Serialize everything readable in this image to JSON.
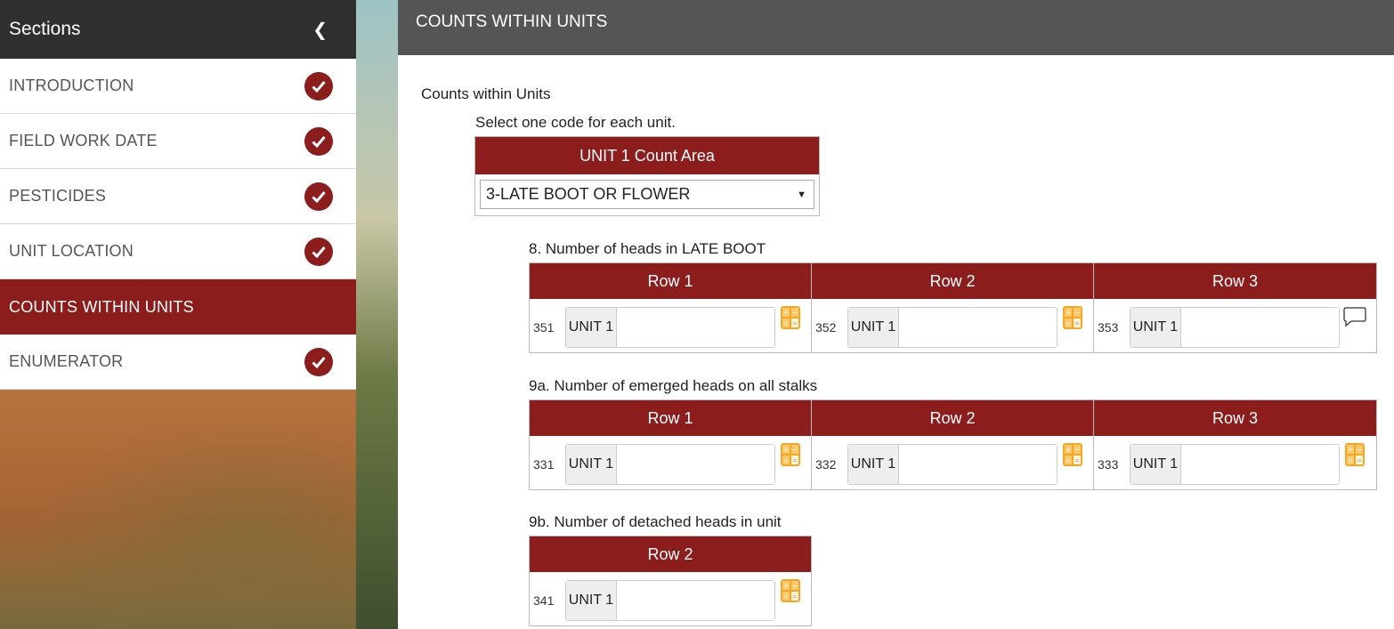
{
  "sidebar": {
    "title": "Sections",
    "collapse_icon": "chevron-left-icon",
    "items": [
      {
        "label": "INTRODUCTION",
        "completed": true
      },
      {
        "label": "FIELD WORK DATE",
        "completed": true
      },
      {
        "label": "PESTICIDES",
        "completed": true
      },
      {
        "label": "UNIT LOCATION",
        "completed": true
      },
      {
        "label": "COUNTS WITHIN UNITS",
        "completed": false,
        "active": true
      },
      {
        "label": "ENUMERATOR",
        "completed": true
      }
    ]
  },
  "main": {
    "header_title": "COUNTS WITHIN UNITS",
    "section_title": "Counts within Units",
    "instruction": "Select one code for each unit.",
    "unit_select": {
      "header": "UNIT 1 Count Area",
      "selected_value": "3-LATE BOOT OR FLOWER"
    },
    "questions": [
      {
        "label": "8. Number of heads in LATE BOOT",
        "columns": [
          {
            "header": "Row 1",
            "code": "351",
            "addon": "UNIT 1",
            "value": ""
          },
          {
            "header": "Row 2",
            "code": "352",
            "addon": "UNIT 1",
            "value": ""
          },
          {
            "header": "Row 3",
            "code": "353",
            "addon": "UNIT 1",
            "value": ""
          }
        ]
      },
      {
        "label": "9a. Number of emerged heads on all stalks",
        "columns": [
          {
            "header": "Row 1",
            "code": "331",
            "addon": "UNIT 1",
            "value": ""
          },
          {
            "header": "Row 2",
            "code": "332",
            "addon": "UNIT 1",
            "value": ""
          },
          {
            "header": "Row 3",
            "code": "333",
            "addon": "UNIT 1",
            "value": ""
          }
        ]
      },
      {
        "label": "9b. Number of detached heads in unit",
        "columns": [
          {
            "header": "Row 2",
            "code": "341",
            "addon": "UNIT 1",
            "value": ""
          }
        ]
      }
    ]
  },
  "colors": {
    "accent": "#8b1d1d",
    "header_dark": "#2f2f2f",
    "main_header": "#555555",
    "calc_icon": "#f5a623"
  }
}
